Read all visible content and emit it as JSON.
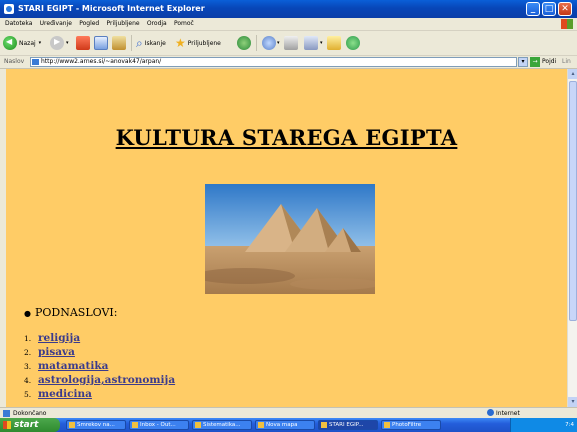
{
  "window": {
    "title": "STARI EGIPT - Microsoft Internet Explorer",
    "minimize": "_",
    "maximize": "□",
    "close": "✕"
  },
  "menu": {
    "items": [
      "Datoteka",
      "Uređivanje",
      "Pogled",
      "Priljubljene",
      "Orodja",
      "Pomoč"
    ]
  },
  "toolbar": {
    "back_label": "Nazaj",
    "search_label": "Iskanje",
    "favorites_label": "Priljubljene"
  },
  "address": {
    "label": "Naslov",
    "url": "http://www2.arnes.si/~anovak47/arpan/",
    "go_label": "Pojdi",
    "links_label": "Lin"
  },
  "page": {
    "heading": "KULTURA STAREGA EGIPTA",
    "subheading": "PODNASLOVI:",
    "topics": [
      {
        "num": "1.",
        "label": "religija"
      },
      {
        "num": "2.",
        "label": "pisava"
      },
      {
        "num": "3.",
        "label": "matamatika"
      },
      {
        "num": "4.",
        "label": "astrologija,astronomija"
      },
      {
        "num": "5.",
        "label": "medicina"
      }
    ],
    "background_color": "#ffcc66",
    "link_color": "#3b3b8c"
  },
  "status": {
    "text": "Dokončano",
    "zone": "Internet"
  },
  "taskbar": {
    "start_label": "start",
    "tasks": [
      "Smrekov na...",
      "Inbox - Out...",
      "Sistematika...",
      "Nova mapa",
      "STARI EGIP...",
      "PhotoFiltre"
    ],
    "clock": "7:4"
  },
  "icons": {
    "back": "back-arrow-icon",
    "forward": "forward-arrow-icon",
    "stop": "stop-icon",
    "refresh": "refresh-icon",
    "home": "home-icon",
    "search": "search-icon",
    "favorites": "favorites-star-icon",
    "history": "history-icon",
    "mail": "mail-icon",
    "print": "print-icon",
    "edit": "edit-icon",
    "folder": "folder-icon",
    "messenger": "messenger-icon"
  }
}
